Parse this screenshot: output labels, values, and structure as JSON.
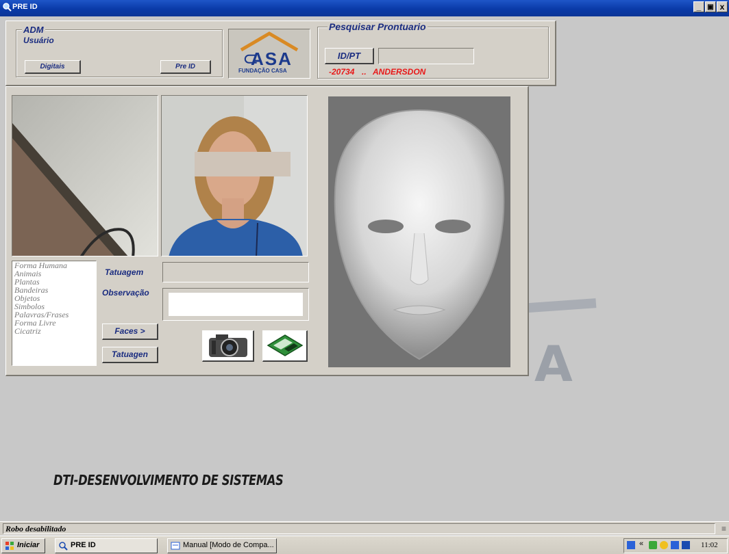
{
  "window": {
    "title": "PRE ID",
    "controls": {
      "minimize": "_",
      "restore": "🗗",
      "close": "x"
    }
  },
  "user_box": {
    "role": "ADM",
    "label": "Usuário",
    "digitais_button": "Digitais",
    "preid_button": "Pre ID"
  },
  "logo": {
    "caption": "FUNDAÇÃO CASA",
    "word": "ASA"
  },
  "search": {
    "title": "Pesquisar Prontuario",
    "id_button": "ID/PT",
    "id_value": "",
    "result_number": "-20734",
    "result_separator": "..",
    "result_name": "ANDERSDON"
  },
  "list_items": [
    "Forma Humana",
    "Animais",
    "Plantas",
    "Bandeiras",
    "Objetos",
    "Simbolos",
    "Palavras/Frases",
    "Forma Livre",
    "Cicatriz"
  ],
  "form": {
    "tatuagem_label": "Tatuagem",
    "tatuagem_value": "",
    "observacao_label": "Observação",
    "observacao_value": "",
    "faces_button": "Faces >",
    "tatuagen_button": "Tatuagen"
  },
  "background_text": "DTI-DESENVOLVIMENTO DE SISTEMAS",
  "background_letter": "A",
  "status": {
    "text": "Robo desabilitado"
  },
  "taskbar": {
    "start": "Iniciar",
    "tasks": [
      "PRE ID",
      "Manual [Modo de Compa..."
    ],
    "clock": "11:02"
  },
  "colors": {
    "accent_blue": "#1a2c80",
    "alert_red": "#e81818",
    "face_panel": "#737373"
  }
}
